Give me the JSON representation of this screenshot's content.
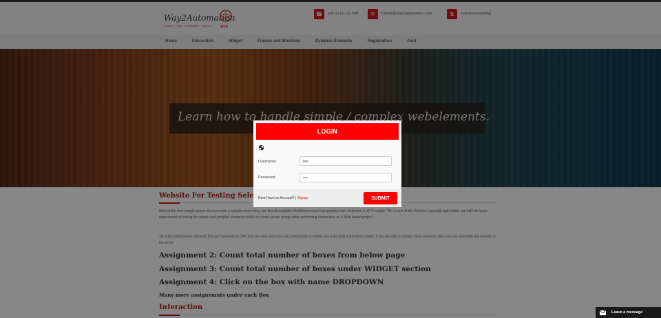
{
  "header": {
    "logo_text": "Way2Automation",
    "logo_tagline": "Explore · Learn · Automation · Improve",
    "logo_badge": "W2A",
    "contacts": [
      {
        "icon": "phone-icon",
        "text": "+91-9711-111-558"
      },
      {
        "icon": "mail-icon",
        "text": "trainer@way2automation.com"
      },
      {
        "icon": "skype-icon",
        "text": "seleniumcoaching"
      }
    ]
  },
  "nav": {
    "items": [
      "Home",
      "Interaction",
      "Widget",
      "Frames and Windows",
      "Dynamic Elements",
      "Registration",
      "Alert"
    ]
  },
  "hero": {
    "text": "Learn how to handle simple / complex webelements."
  },
  "content": {
    "section1_title": "Website For Testing Selenium",
    "para1": "Most of the time people asked me to provide a website where they can find all available WebElement and can practice their Selenium or QTP scripts. This is one of the Website I specially built which can fulfil the basic requirement of testing the simple and complex elements which we come across mostly while performing Automation on a Web based project .",
    "para2": "Try automating below elements through Selenium or QTP and see how much you are comfortable in writing and executing automation scripts. If you are able to handle these elements then you can automate any website in the world.",
    "assignments": [
      "Assignment 2: Count total number of boxes from below page",
      "Assignment 3: Count total number of boxes under WIDGET section",
      "Assignment 4: Click on the box with name DROPDOWN"
    ],
    "more": "Many more assignemnts under each Box",
    "section2_title": "Interaction"
  },
  "login": {
    "title": "LOGIN",
    "username_label": "Username:",
    "username_value": "test",
    "password_label": "Password:",
    "password_value": "••••",
    "no_account_text": "Dont Have an Account? |",
    "signup_label": "Signup",
    "submit_label": "SUBMIT"
  },
  "chat": {
    "label": "Leave a message"
  },
  "colors": {
    "accent": "#ff0000",
    "brand_red": "#d0181b"
  }
}
